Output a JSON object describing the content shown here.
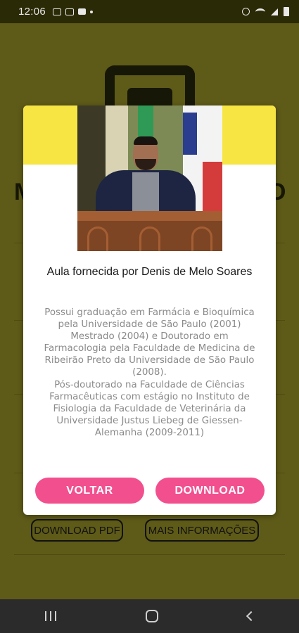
{
  "status_bar": {
    "time": "12:06",
    "left_icons": [
      "image-icon",
      "mail-icon",
      "video-icon",
      "dot-icon"
    ],
    "right_icons": [
      "alarm-icon",
      "wifi-icon",
      "signal-icon",
      "battery-icon"
    ]
  },
  "background": {
    "title_left": "M",
    "title_right": "O",
    "buttons": {
      "download_pdf": "DOWNLOAD PDF",
      "more_info": "MAIS INFORMAÇÕES"
    }
  },
  "dialog": {
    "title": "Aula fornecida por Denis de Melo Soares",
    "description": "Possui graduação em Farmácia e Bioquímica pela Universidade de São Paulo (2001)\nMestrado (2004) e Doutorado em Farmacologia pela Faculdade de Medicina de Ribeirão Preto da Universidade de São Paulo (2008).\nPós-doutorado na Faculdade de Ciências Farmacêuticas com estágio no Instituto de Fisiologia da Faculdade de Veterinária da Universidade Justus Liebeg de Giessen-Alemanha (2009-2011)",
    "back_label": "VOLTAR",
    "download_label": "DOWNLOAD"
  },
  "colors": {
    "accent_pink": "#f24f8e",
    "band_yellow": "#f7e544",
    "overlay_olive": "#5e5a18"
  },
  "nav_bar": {
    "icons": [
      "recents-icon",
      "home-icon",
      "back-icon"
    ]
  }
}
